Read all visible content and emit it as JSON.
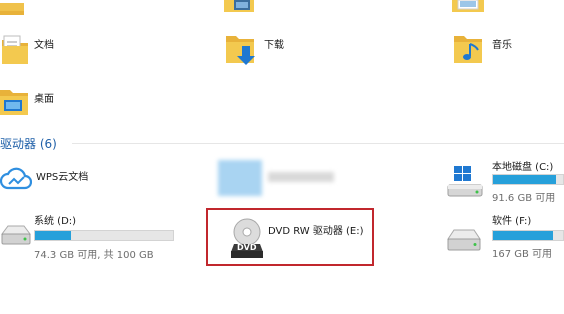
{
  "folders": {
    "documents": "文档",
    "downloads": "下载",
    "music": "音乐",
    "desktop": "桌面"
  },
  "section": {
    "title": "驱动器 (6)"
  },
  "drives": {
    "wps": {
      "name": "WPS云文档"
    },
    "c": {
      "name": "本地磁盘 (C:)",
      "free": "91.6 GB 可用",
      "used_fraction": 0.9
    },
    "d": {
      "name": "系统 (D:)",
      "free": "74.3 GB 可用, 共 100 GB",
      "used_fraction": 0.26
    },
    "e": {
      "name": "DVD RW 驱动器 (E:)",
      "icon_text": "DVD"
    },
    "f": {
      "name": "软件 (F:)",
      "free": "167 GB 可用",
      "used_fraction": 0.85
    }
  },
  "colors": {
    "accent": "#26a0da",
    "highlight": "#c1272d",
    "section_text": "#1e5fa8"
  }
}
